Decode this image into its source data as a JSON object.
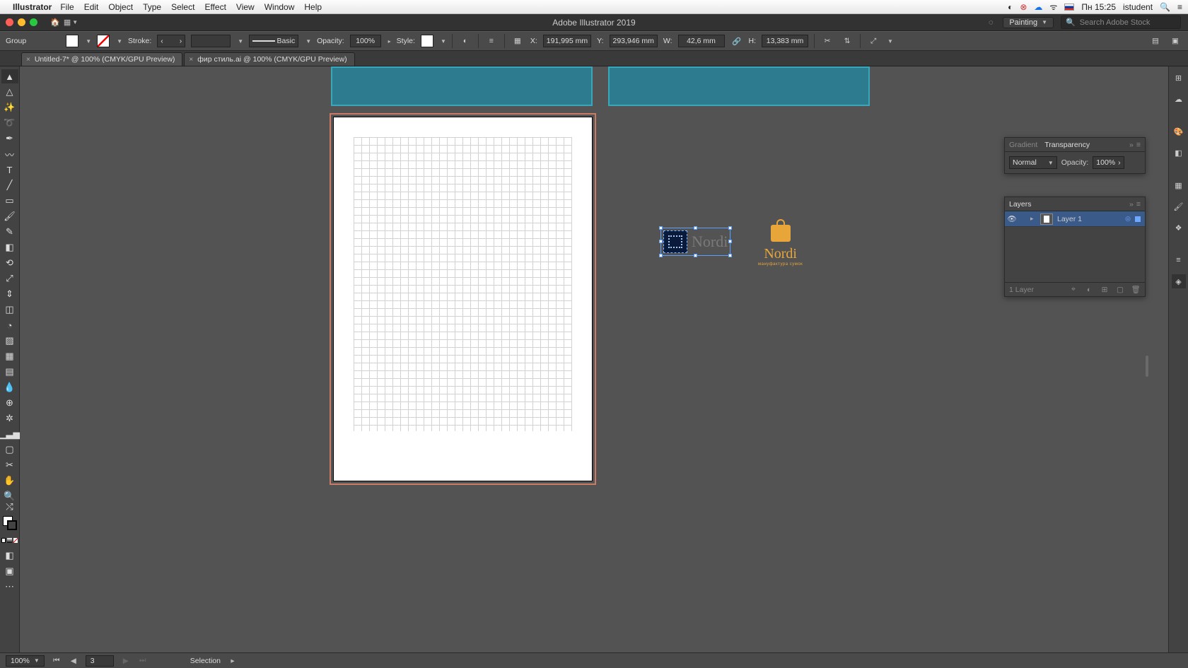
{
  "mac": {
    "app_name": "Illustrator",
    "menus": [
      "File",
      "Edit",
      "Object",
      "Type",
      "Select",
      "Effect",
      "View",
      "Window",
      "Help"
    ],
    "clock": "Пн 15:25",
    "user": "istudent"
  },
  "app_title": "Adobe Illustrator 2019",
  "workspace_switcher": "Painting",
  "search_stock_placeholder": "Search Adobe Stock",
  "control": {
    "selection_kind": "Group",
    "stroke_label": "Stroke:",
    "stroke_weight": "",
    "profile": "Basic",
    "opacity_label": "Opacity:",
    "opacity_value": "100%",
    "style_label": "Style:",
    "x_label": "X:",
    "x_value": "191,995 mm",
    "y_label": "Y:",
    "y_value": "293,946 mm",
    "w_label": "W:",
    "w_value": "42,6 mm",
    "h_label": "H:",
    "h_value": "13,383 mm"
  },
  "tabs": [
    {
      "label": "Untitled-7* @ 100% (CMYK/GPU Preview)",
      "active": true
    },
    {
      "label": "фир стиль.ai @ 100% (CMYK/GPU Preview)",
      "active": false
    }
  ],
  "canvas": {
    "logo_a_text": "Nordi",
    "logo_b_text": "Nordi",
    "logo_b_tag": "мануфактура сумок"
  },
  "transparency_panel": {
    "tab_gradient": "Gradient",
    "tab_transparency": "Transparency",
    "blend_mode": "Normal",
    "opacity_label": "Opacity:",
    "opacity_value": "100%"
  },
  "layers_panel": {
    "title": "Layers",
    "layer_name": "Layer 1",
    "footer_count": "1 Layer"
  },
  "status": {
    "zoom": "100%",
    "artboard_no": "3",
    "tool": "Selection"
  }
}
